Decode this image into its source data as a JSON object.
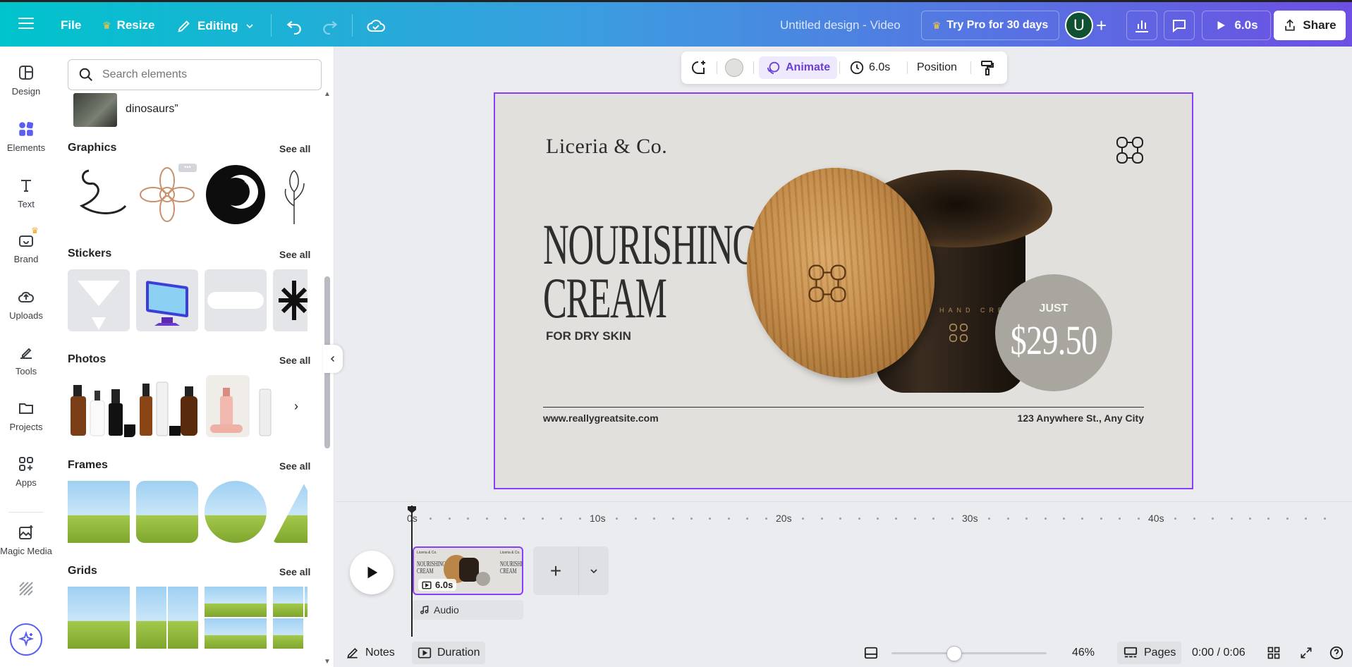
{
  "topbar": {
    "file": "File",
    "resize": "Resize",
    "editing": "Editing",
    "title": "Untitled design - Video",
    "try_pro": "Try Pro for 30 days",
    "avatar_letter": "U",
    "play_duration": "6.0s",
    "share": "Share"
  },
  "rail": {
    "design": "Design",
    "elements": "Elements",
    "text": "Text",
    "brand": "Brand",
    "uploads": "Uploads",
    "tools": "Tools",
    "projects": "Projects",
    "apps": "Apps",
    "magic_media": "Magic Media"
  },
  "panel": {
    "search_placeholder": "Search elements",
    "prev_item_text": "dinosaurs”",
    "see_all": "See all",
    "sections": {
      "graphics": "Graphics",
      "stickers": "Stickers",
      "photos": "Photos",
      "frames": "Frames",
      "grids": "Grids"
    }
  },
  "context_toolbar": {
    "animate": "Animate",
    "duration": "6.0s",
    "position": "Position"
  },
  "design": {
    "brand": "Liceria & Co.",
    "headline_line1": "NOURISHING",
    "headline_line2": "CREAM",
    "subhead": "FOR DRY SKIN",
    "jar_label": "HAND CREAM",
    "price_prefix": "JUST",
    "price": "$29.50",
    "website": "www.reallygreatsite.com",
    "address": "123 Anywhere St., Any City"
  },
  "timeline": {
    "ticks": [
      "0s",
      "10s",
      "20s",
      "30s",
      "40s"
    ],
    "clip_duration": "6.0s",
    "audio": "Audio"
  },
  "bottombar": {
    "notes": "Notes",
    "duration": "Duration",
    "zoom": "46%",
    "pages": "Pages",
    "time": "0:00 / 0:06"
  },
  "colors": {
    "accent": "#8b3dff",
    "design_bg": "#e1e0dc",
    "price_circle": "#a8a69e"
  }
}
